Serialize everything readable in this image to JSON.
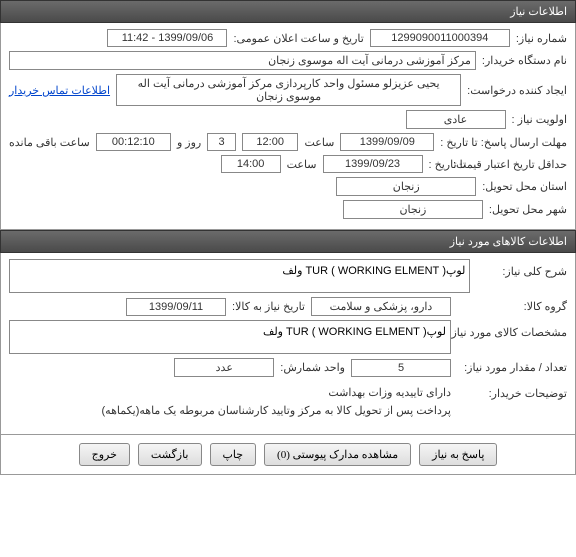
{
  "section1": {
    "title": "اطلاعات نیاز",
    "need_number_label": "شماره نیاز:",
    "need_number": "1299090011000394",
    "announce_datetime_label": "تاریخ و ساعت اعلان عمومی:",
    "announce_datetime": "1399/09/06 - 11:42",
    "buyer_org_label": "نام دستگاه خریدار:",
    "buyer_org": "مرکز آموزشی درمانی آیت اله موسوی زنجان",
    "requester_label": "ایجاد کننده درخواست:",
    "requester": "یحیی عزیزلو مسئول واحد کارپردازی مرکز آموزشی درمانی آیت اله موسوی زنجان",
    "contact_link": "اطلاعات تماس خریدار",
    "priority_label": "اولویت نیاز :",
    "priority": "عادی",
    "deadline_label": "مهلت ارسال پاسخ:  تا تاریخ :",
    "deadline_date": "1399/09/09",
    "time_label": "ساعت",
    "deadline_time": "12:00",
    "days_remaining": "3",
    "days_label": "روز و",
    "hours_remaining": "00:12:10",
    "remaining_label": "ساعت باقی مانده",
    "validity_label": "حداقل تاریخ اعتبار قیمت:",
    "validity_to_label": "تا تاریخ :",
    "validity_date": "1399/09/23",
    "validity_time": "14:00",
    "delivery_province_label": "استان محل تحویل:",
    "delivery_province": "زنجان",
    "delivery_city_label": "شهر محل تحویل:",
    "delivery_city": "زنجان"
  },
  "section2": {
    "title": "اطلاعات کالاهای مورد نیاز",
    "overall_desc_label": "شرح کلی نیاز:",
    "overall_desc": "لوپ( TUR ( WORKING ELMENT ولف",
    "goods_group_label": "گروه کالا:",
    "goods_group": "دارو، پزشکی و سلامت",
    "need_date_label": "تاریخ نیاز به کالا:",
    "need_date": "1399/09/11",
    "goods_spec_label": "مشخصات کالای مورد نیاز:",
    "goods_spec": "لوپ( TUR ( WORKING ELMENT ولف",
    "quantity_label": "تعداد / مقدار مورد نیاز:",
    "quantity": "5",
    "unit_label": "واحد شمارش:",
    "unit": "عدد",
    "buyer_notes_label": "توضیحات خریدار:",
    "buyer_notes_line1": "دارای تاییدیه وزات بهداشت",
    "buyer_notes_line2": "پرداخت پس از تحویل کالا به مرکز وتایید کارشناسان مربوطه یک ماهه(یکماهه)"
  },
  "buttons": {
    "respond": "پاسخ به نیاز",
    "attachments": "مشاهده مدارک پیوستی (0)",
    "print": "چاپ",
    "back": "بازگشت",
    "exit": "خروج"
  }
}
